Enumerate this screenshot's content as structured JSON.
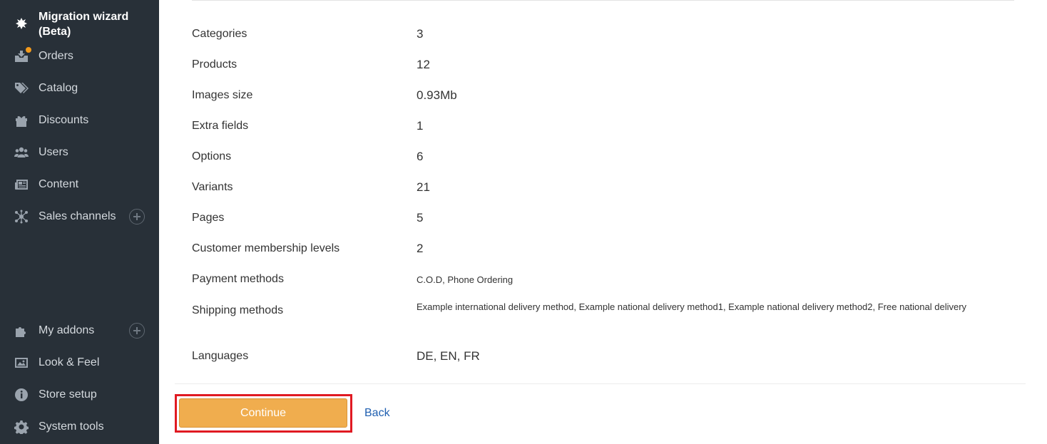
{
  "sidebar": {
    "title_line1": "Migration wizard",
    "title_line2": "(Beta)",
    "items": [
      {
        "label": "Orders",
        "icon": "orders-icon"
      },
      {
        "label": "Catalog",
        "icon": "tags-icon"
      },
      {
        "label": "Discounts",
        "icon": "gift-icon"
      },
      {
        "label": "Users",
        "icon": "users-icon"
      },
      {
        "label": "Content",
        "icon": "newspaper-icon"
      },
      {
        "label": "Sales channels",
        "icon": "network-icon"
      },
      {
        "label": "My addons",
        "icon": "puzzle-icon"
      },
      {
        "label": "Look & Feel",
        "icon": "image-icon"
      },
      {
        "label": "Store setup",
        "icon": "info-icon"
      },
      {
        "label": "System tools",
        "icon": "gear-icon"
      }
    ],
    "notification_color": "#f39a1c"
  },
  "summary": [
    {
      "key": "Categories",
      "value": "3"
    },
    {
      "key": "Products",
      "value": "12"
    },
    {
      "key": "Images size",
      "value": "0.93Mb"
    },
    {
      "key": "Extra fields",
      "value": "1"
    },
    {
      "key": "Options",
      "value": "6"
    },
    {
      "key": "Variants",
      "value": "21"
    },
    {
      "key": "Pages",
      "value": "5"
    },
    {
      "key": "Customer membership levels",
      "value": "2"
    },
    {
      "key": "Payment methods",
      "value": "C.O.D, Phone Ordering"
    },
    {
      "key": "Shipping methods",
      "value": "Example international delivery method, Example national delivery method1, Example national delivery method2, Free national delivery"
    },
    {
      "key": "Languages",
      "value": "DE, EN, FR"
    }
  ],
  "actions": {
    "continue_label": "Continue",
    "back_label": "Back"
  },
  "colors": {
    "sidebar_bg": "#283038",
    "accent": "#f0ad4e",
    "highlight": "#e01a22",
    "link": "#1f5fb0"
  }
}
